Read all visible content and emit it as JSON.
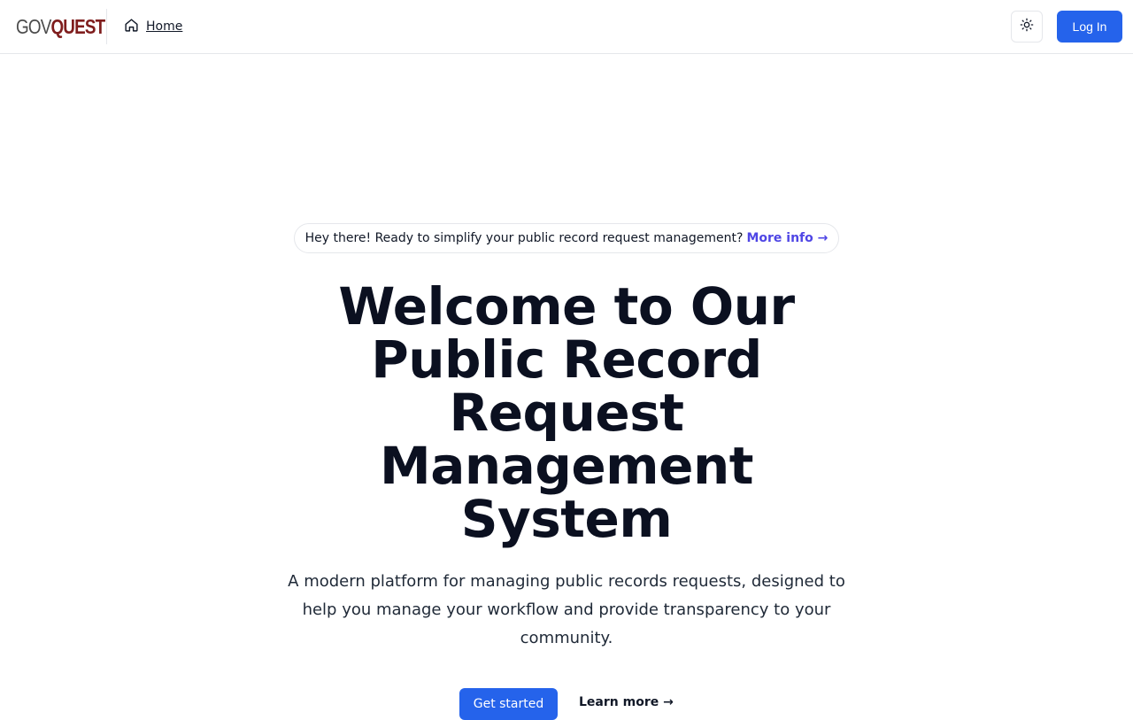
{
  "header": {
    "logo": {
      "part1": "GOV",
      "part2": "QUEST"
    },
    "home_label": "Home",
    "home_icon": "home-icon",
    "theme_toggle_icon": "sun-icon",
    "login_label": "Log In"
  },
  "announcement": {
    "text": "Hey there! Ready to simplify your public record request management?",
    "link_label": "More info →"
  },
  "hero": {
    "title": "Welcome to Our Public Record Request Management System",
    "subtitle": "A modern platform for managing public records requests, designed to help you manage your workflow and provide transparency to your community.",
    "primary_cta": "Get started",
    "secondary_cta": "Learn more →"
  },
  "colors": {
    "accent": "#2563eb",
    "link": "#4f46e5",
    "logo_gov": "#4b4b4b",
    "logo_quest": "#7f1d1d"
  }
}
